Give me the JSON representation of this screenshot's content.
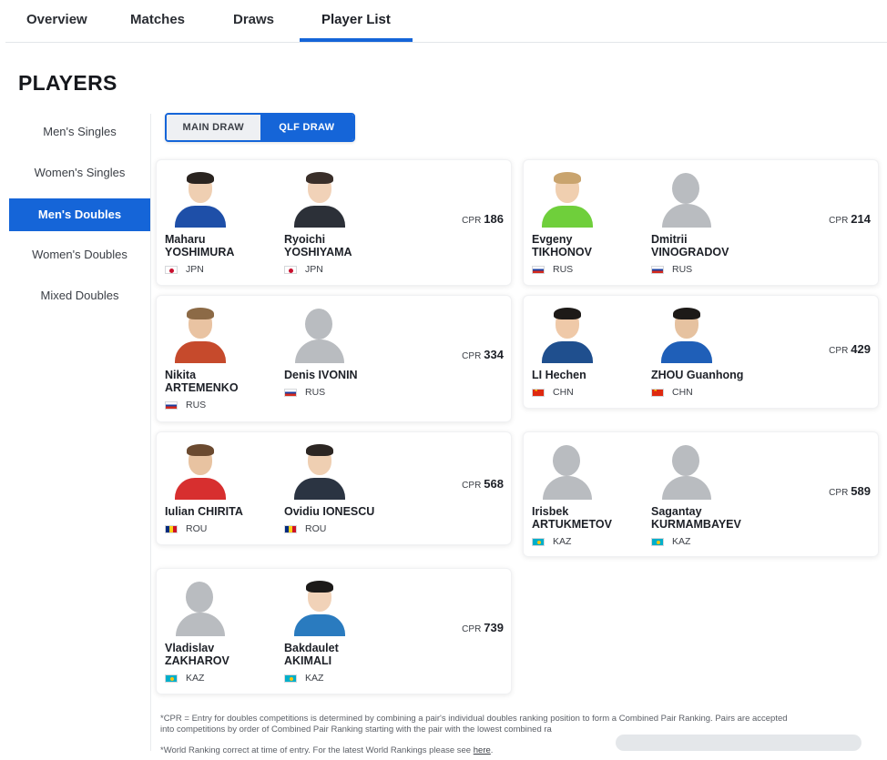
{
  "tabs": [
    {
      "label": "Overview"
    },
    {
      "label": "Matches"
    },
    {
      "label": "Draws"
    },
    {
      "label": "Player List"
    }
  ],
  "page_title": "PLAYERS",
  "sidebar": {
    "items": [
      {
        "label": "Men's Singles"
      },
      {
        "label": "Women's Singles"
      },
      {
        "label": "Men's Doubles"
      },
      {
        "label": "Women's Doubles"
      },
      {
        "label": "Mixed Doubles"
      }
    ],
    "active": "Men's Doubles"
  },
  "draw_toggle": {
    "main": "MAIN DRAW",
    "qlf": "QLF DRAW",
    "selected": "QLF DRAW"
  },
  "cpr_label": "CPR",
  "pairs": [
    {
      "cpr": "186",
      "players": [
        {
          "first": "Maharu",
          "last": "YOSHIMURA",
          "country": "JPN",
          "photo": "player-photo"
        },
        {
          "first": "Ryoichi",
          "last": "YOSHIYAMA",
          "country": "JPN",
          "photo": "player-photo"
        }
      ]
    },
    {
      "cpr": "214",
      "players": [
        {
          "first": "Evgeny",
          "last": "TIKHONOV",
          "country": "RUS",
          "photo": "player-photo"
        },
        {
          "first": "Dmitrii",
          "last": "VINOGRADOV",
          "country": "RUS",
          "photo": "avatar-placeholder"
        }
      ]
    },
    {
      "cpr": "334",
      "players": [
        {
          "first": "Nikita",
          "last": "ARTEMENKO",
          "country": "RUS",
          "photo": "player-photo"
        },
        {
          "first": "",
          "last": "Denis IVONIN",
          "country": "RUS",
          "photo": "avatar-placeholder"
        }
      ]
    },
    {
      "cpr": "429",
      "players": [
        {
          "first": "",
          "last": "LI Hechen",
          "country": "CHN",
          "photo": "player-photo"
        },
        {
          "first": "",
          "last": "ZHOU Guanhong",
          "country": "CHN",
          "photo": "player-photo"
        }
      ]
    },
    {
      "cpr": "568",
      "players": [
        {
          "first": "",
          "last": "Iulian CHIRITA",
          "country": "ROU",
          "photo": "player-photo"
        },
        {
          "first": "",
          "last": "Ovidiu IONESCU",
          "country": "ROU",
          "photo": "player-photo"
        }
      ]
    },
    {
      "cpr": "589",
      "players": [
        {
          "first": "Irisbek",
          "last": "ARTUKMETOV",
          "country": "KAZ",
          "photo": "avatar-placeholder"
        },
        {
          "first": "Sagantay",
          "last": "KURMAMBAYEV",
          "country": "KAZ",
          "photo": "avatar-placeholder"
        }
      ]
    },
    {
      "cpr": "739",
      "players": [
        {
          "first": "Vladislav",
          "last": "ZAKHAROV",
          "country": "KAZ",
          "photo": "avatar-placeholder"
        },
        {
          "first": "Bakdaulet",
          "last": "AKIMALI",
          "country": "KAZ",
          "photo": "player-photo"
        }
      ]
    }
  ],
  "footnotes": {
    "cpr_note_line1": "*CPR = Entry for doubles competitions is determined by combining a pair's individual doubles ranking position to form a Combined Pair Ranking. Pairs are accepted",
    "cpr_note_line2": "into competitions by order of Combined Pair Ranking starting with the pair with the lowest combined ra",
    "ranking_note": "*World Ranking correct at time of entry. For the latest World Rankings please see ",
    "ranking_link": "here",
    "ranking_end": "."
  },
  "colors": {
    "accent": "#1565d8",
    "text": "#1d2027",
    "muted": "#3b3f46",
    "divider": "#e3e6ea",
    "placeholder": "#b9bcc0"
  }
}
